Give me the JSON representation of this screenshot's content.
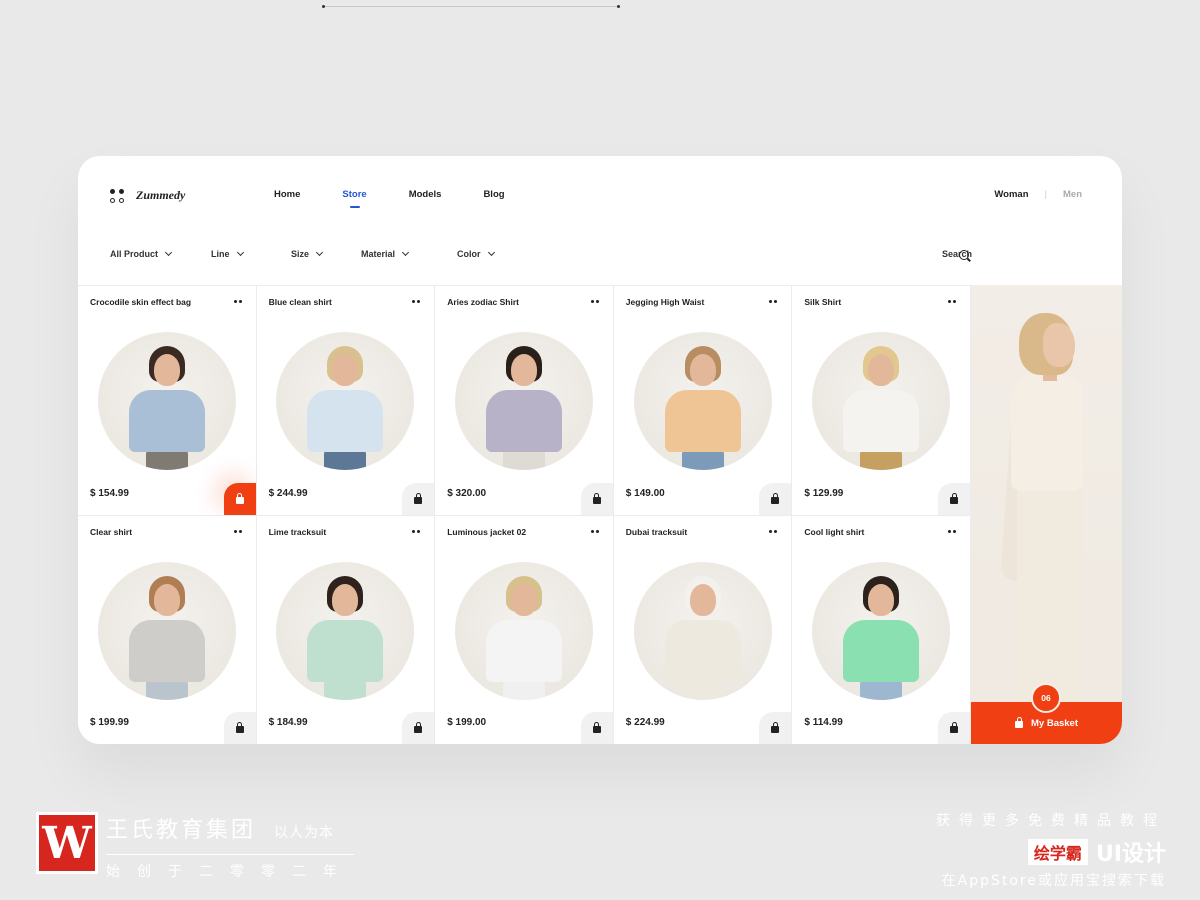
{
  "header": {
    "logo_text": "Zummedy",
    "nav": [
      "Home",
      "Store",
      "Models",
      "Blog"
    ],
    "active_nav": "Store",
    "gender": {
      "woman": "Woman",
      "separator": "|",
      "men": "Men"
    }
  },
  "filters": [
    "All Product",
    "Line",
    "Size",
    "Material",
    "Color"
  ],
  "search": {
    "label": "Search"
  },
  "products": [
    {
      "name": "Crocodile skin effect bag",
      "price": "$ 154.99",
      "highlighted": true,
      "hair": "#3b2a22",
      "body": "#a9bfd6",
      "legs": "#7f7a72"
    },
    {
      "name": "Blue clean shirt",
      "price": "$ 244.99",
      "highlighted": false,
      "hair": "#d9c08f",
      "body": "#d5e3ef",
      "legs": "#5c7896"
    },
    {
      "name": "Aries zodiac Shirt",
      "price": "$ 320.00",
      "highlighted": false,
      "hair": "#2a201b",
      "body": "#b7b2c8",
      "legs": "#dedbd4"
    },
    {
      "name": "Jegging High Waist",
      "price": "$ 149.00",
      "highlighted": false,
      "hair": "#b98d62",
      "body": "#efc596",
      "legs": "#7d9ab8"
    },
    {
      "name": "Silk Shirt",
      "price": "$ 129.99",
      "highlighted": false,
      "hair": "#e2c88e",
      "body": "#f5f3ef",
      "legs": "#c6a060"
    },
    {
      "name": "Clear shirt",
      "price": "$ 199.99",
      "highlighted": false,
      "hair": "#b07e52",
      "body": "#cfcdc9",
      "legs": "#b9c4cc"
    },
    {
      "name": "Lime tracksuit",
      "price": "$ 184.99",
      "highlighted": false,
      "hair": "#2f221c",
      "body": "#bfe0cf",
      "legs": "#bfe0cf"
    },
    {
      "name": "Luminous jacket 02",
      "price": "$ 199.00",
      "highlighted": false,
      "hair": "#d8c08c",
      "body": "#f4f4f4",
      "legs": "#f0f0f0"
    },
    {
      "name": "Dubai tracksuit",
      "price": "$ 224.99",
      "highlighted": false,
      "hair": "#f3f1ec",
      "body": "#eee9df",
      "legs": "#eee9df"
    },
    {
      "name": "Cool light shirt",
      "price": "$ 114.99",
      "highlighted": false,
      "hair": "#2c211c",
      "body": "#8be0b1",
      "legs": "#9cb7cf"
    }
  ],
  "basket": {
    "count": "06",
    "label": "My Basket"
  },
  "colors": {
    "accent": "#f03f12",
    "active_nav": "#2356d6"
  },
  "watermark": {
    "left_line1": "王氏教育集团",
    "left_line1_small": "以人为本",
    "left_line2": "始创于二零零二年",
    "left_logo": "W",
    "right_line1": "获得更多免费精品教程",
    "right_brand": "绘学霸",
    "right_ui": "UI设计",
    "right_line3": "在AppStore或应用宝搜索下载"
  }
}
